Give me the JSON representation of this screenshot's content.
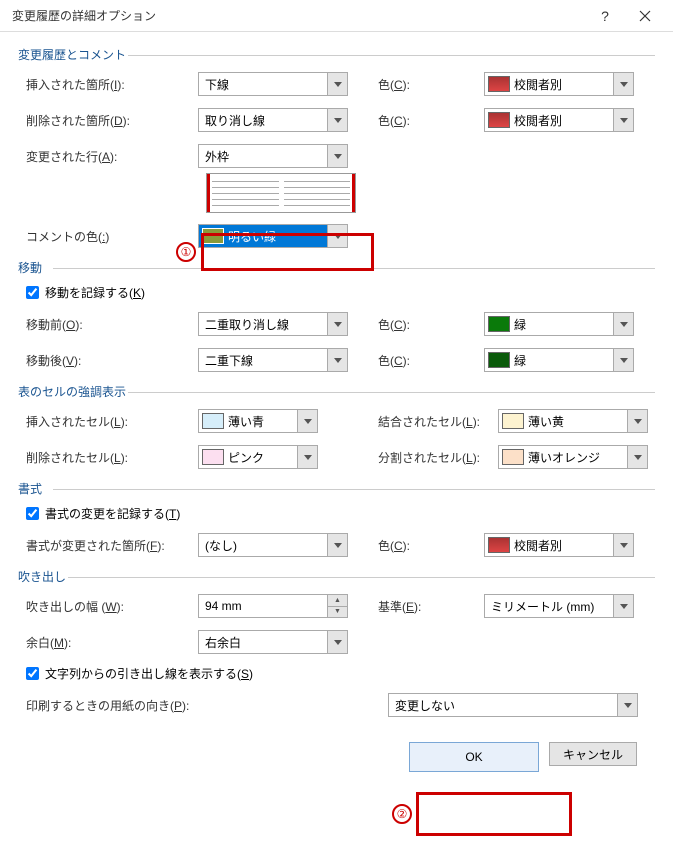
{
  "title": "変更履歴の詳細オプション",
  "sections": {
    "changes": "変更履歴とコメント",
    "moves": "移動",
    "cells": "表のセルの強調表示",
    "format": "書式",
    "balloons": "吹き出し"
  },
  "labels": {
    "inserted": "挿入された箇所(I):",
    "deleted": "削除された箇所(D):",
    "changed_line": "変更された行(A):",
    "comment_color": "コメントの色(:)",
    "color": "色(C):",
    "track_moves": "移動を記録する(K)",
    "move_from": "移動前(O):",
    "move_to": "移動後(V):",
    "ins_cell": "挿入されたセル(L):",
    "del_cell": "削除されたセル(L):",
    "merge_cell": "結合されたセル(L):",
    "split_cell": "分割されたセル(L):",
    "track_format": "書式の変更を記録する(T)",
    "format_at": "書式が変更された箇所(F):",
    "balloon_width": "吹き出しの幅 (W):",
    "margin": "余白(M):",
    "draw_lines": "文字列からの引き出し線を表示する(S)",
    "print_orient": "印刷するときの用紙の向き(P):",
    "measure": "基準(E):"
  },
  "values": {
    "inserted": "下線",
    "deleted": "取り消し線",
    "changed_line": "外枠",
    "comment_color": "明るい緑",
    "by_reviewer": "校閲者別",
    "move_from": "二重取り消し線",
    "move_to": "二重下線",
    "green": "緑",
    "darkgreen": "緑",
    "ins_cell": "薄い青",
    "del_cell": "ピンク",
    "merge_cell": "薄い黄",
    "split_cell": "薄いオレンジ",
    "format_at": "(なし)",
    "balloon_width": "94 mm",
    "margin": "右余白",
    "print_orient": "変更しない",
    "measure": "ミリメートル (mm)"
  },
  "buttons": {
    "ok": "OK",
    "cancel": "キャンセル"
  },
  "markers": {
    "m1": "①",
    "m2": "②"
  }
}
